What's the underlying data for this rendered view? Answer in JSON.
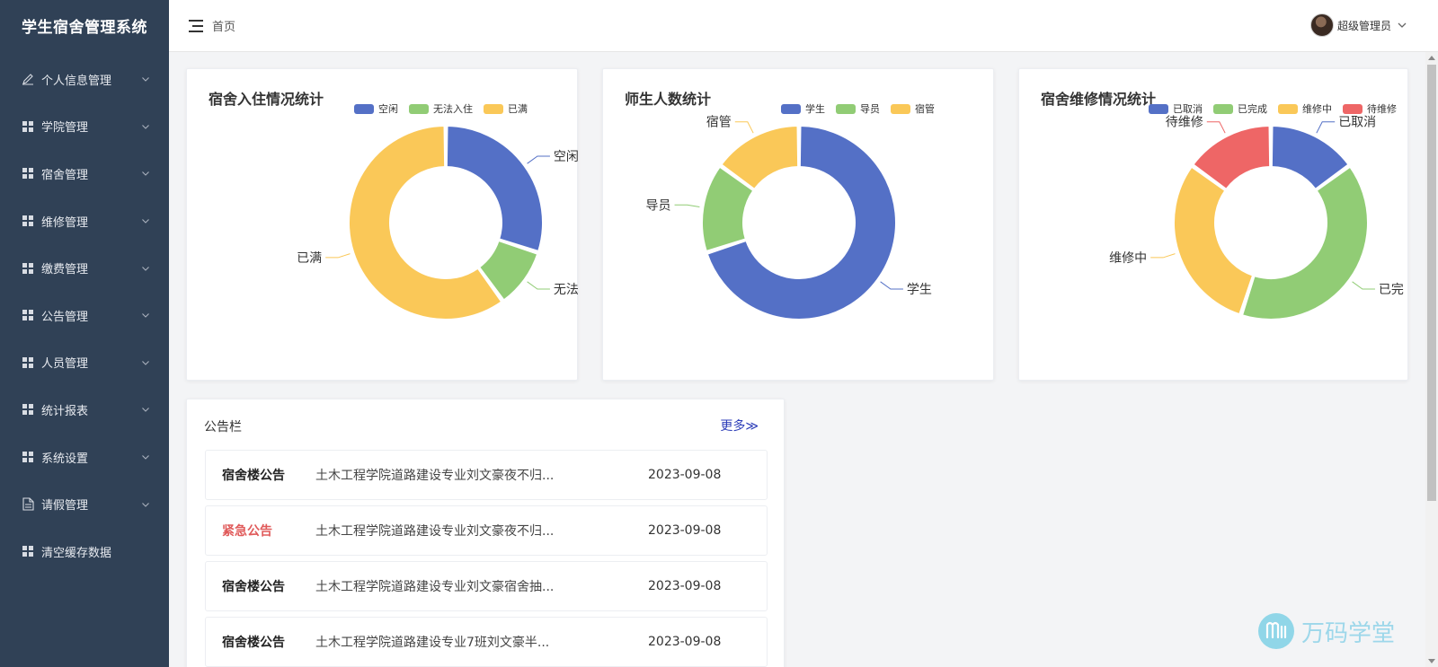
{
  "app": {
    "title": "学生宿舍管理系统"
  },
  "sidebar": {
    "items": [
      {
        "label": "个人信息管理",
        "icon": "edit-icon",
        "expandable": true
      },
      {
        "label": "学院管理",
        "icon": "grid-icon",
        "expandable": true
      },
      {
        "label": "宿舍管理",
        "icon": "grid-icon",
        "expandable": true
      },
      {
        "label": "维修管理",
        "icon": "grid-icon",
        "expandable": true
      },
      {
        "label": "缴费管理",
        "icon": "grid-icon",
        "expandable": true
      },
      {
        "label": "公告管理",
        "icon": "grid-icon",
        "expandable": true
      },
      {
        "label": "人员管理",
        "icon": "grid-icon",
        "expandable": true
      },
      {
        "label": "统计报表",
        "icon": "grid-icon",
        "expandable": true
      },
      {
        "label": "系统设置",
        "icon": "grid-icon",
        "expandable": true
      },
      {
        "label": "请假管理",
        "icon": "document-icon",
        "expandable": true
      },
      {
        "label": "清空缓存数据",
        "icon": "grid-icon",
        "expandable": false
      }
    ]
  },
  "header": {
    "breadcrumb": "首页",
    "user_name": "超级管理员"
  },
  "colors": {
    "blue": "#5470c6",
    "green": "#91cc75",
    "yellow": "#fac858",
    "red": "#ee6666",
    "sidebar_bg": "#304156",
    "link": "#2c3db8"
  },
  "chart_data": [
    {
      "type": "pie",
      "donut": true,
      "title": "宿舍入住情况统计",
      "legend": [
        "空闲",
        "无法入住",
        "已满"
      ],
      "labels": [
        "空闲",
        "无法入",
        "已满"
      ],
      "values": [
        30,
        10,
        60
      ],
      "colors": [
        "#5470c6",
        "#91cc75",
        "#fac858"
      ]
    },
    {
      "type": "pie",
      "donut": true,
      "title": "师生人数统计",
      "legend": [
        "学生",
        "导员",
        "宿管"
      ],
      "labels": [
        "学生",
        "导员",
        "宿管"
      ],
      "values": [
        70,
        15,
        15
      ],
      "colors": [
        "#5470c6",
        "#91cc75",
        "#fac858"
      ]
    },
    {
      "type": "pie",
      "donut": true,
      "title": "宿舍维修情况统计",
      "legend": [
        "已取消",
        "已完成",
        "维修中",
        "待维修"
      ],
      "labels": [
        "已取消",
        "已完",
        "维修中",
        "待维修"
      ],
      "values": [
        15,
        40,
        30,
        15
      ],
      "colors": [
        "#5470c6",
        "#91cc75",
        "#fac858",
        "#ee6666"
      ]
    }
  ],
  "notice": {
    "title": "公告栏",
    "more": "更多≫",
    "rows": [
      {
        "type": "宿舍楼公告",
        "urgent": false,
        "text": "土木工程学院道路建设专业刘文豪夜不归...",
        "date": "2023-09-08"
      },
      {
        "type": "紧急公告",
        "urgent": true,
        "text": "土木工程学院道路建设专业刘文豪夜不归...",
        "date": "2023-09-08"
      },
      {
        "type": "宿舍楼公告",
        "urgent": false,
        "text": "土木工程学院道路建设专业刘文豪宿舍抽...",
        "date": "2023-09-08"
      },
      {
        "type": "宿舍楼公告",
        "urgent": false,
        "text": "土木工程学院道路建设专业7班刘文豪半...",
        "date": "2023-09-08"
      }
    ]
  },
  "watermark": {
    "text": "万码学堂"
  }
}
